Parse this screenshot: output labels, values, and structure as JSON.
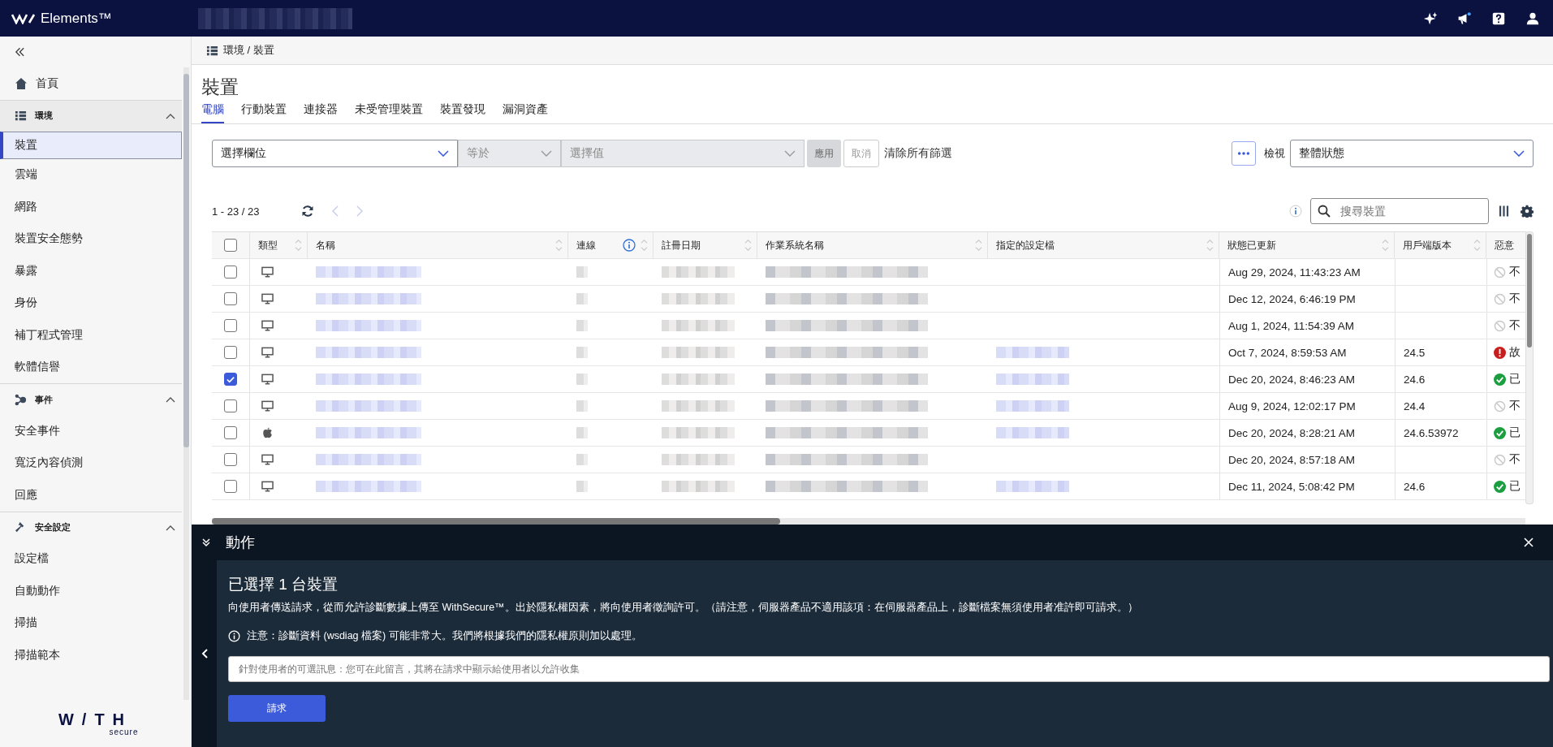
{
  "topbar": {
    "product": "Elements™"
  },
  "sidebar": {
    "home": "首頁",
    "sections": [
      {
        "title": "環境",
        "active": true,
        "expanded": true,
        "items": [
          {
            "label": "裝置",
            "selected": true
          },
          {
            "label": "雲端",
            "selected": false
          },
          {
            "label": "網路",
            "selected": false
          },
          {
            "label": "裝置安全態勢",
            "selected": false
          },
          {
            "label": "暴露",
            "selected": false
          },
          {
            "label": "身份",
            "selected": false
          },
          {
            "label": "補丁程式管理",
            "selected": false
          },
          {
            "label": "軟體信譽",
            "selected": false
          }
        ]
      },
      {
        "title": "事件",
        "active": false,
        "expanded": true,
        "items": [
          {
            "label": "安全事件",
            "selected": false
          },
          {
            "label": "寬泛內容偵測",
            "selected": false
          },
          {
            "label": "回應",
            "selected": false
          }
        ]
      },
      {
        "title": "安全設定",
        "active": false,
        "expanded": true,
        "items": [
          {
            "label": "設定檔",
            "selected": false
          },
          {
            "label": "自動動作",
            "selected": false
          },
          {
            "label": "掃描",
            "selected": false
          },
          {
            "label": "掃描範本",
            "selected": false
          }
        ]
      }
    ],
    "logo": "W/TH",
    "logo_sub": "secure"
  },
  "breadcrumb": "環境 / 裝置",
  "page_title": "裝置",
  "tabs": [
    {
      "label": "電腦",
      "selected": true
    },
    {
      "label": "行動裝置",
      "selected": false
    },
    {
      "label": "連接器",
      "selected": false
    },
    {
      "label": "未受管理裝置",
      "selected": false
    },
    {
      "label": "裝置發現",
      "selected": false
    },
    {
      "label": "漏洞資產",
      "selected": false
    }
  ],
  "filter": {
    "field": "選擇欄位",
    "operator": "等於",
    "value_placeholder": "選擇值",
    "apply": "應用",
    "cancel": "取消",
    "clear": "清除所有篩選",
    "view_label": "檢視",
    "view": "整體狀態"
  },
  "count": "1 - 23 / 23",
  "search": {
    "placeholder": "搜尋裝置"
  },
  "table": {
    "select_all": false,
    "columns": [
      "類型",
      "名稱",
      "連線",
      "註冊日期",
      "作業系統名稱",
      "指定的設定檔",
      "狀態已更新",
      "用戶端版本",
      "惡意"
    ],
    "rows": [
      {
        "checked": false,
        "kind": "pc",
        "profile": false,
        "updated": "Aug 29, 2024, 11:43:23 AM",
        "version": "",
        "malware": {
          "kind": "none",
          "text": "不"
        }
      },
      {
        "checked": false,
        "kind": "pc",
        "profile": false,
        "updated": "Dec 12, 2024, 6:46:19 PM",
        "version": "",
        "malware": {
          "kind": "none",
          "text": "不"
        }
      },
      {
        "checked": false,
        "kind": "pc",
        "profile": false,
        "updated": "Aug 1, 2024, 11:54:39 AM",
        "version": "",
        "malware": {
          "kind": "none",
          "text": "不"
        }
      },
      {
        "checked": false,
        "kind": "pc",
        "profile": true,
        "updated": "Oct 7, 2024, 8:59:53 AM",
        "version": "24.5",
        "malware": {
          "kind": "error",
          "text": "故"
        }
      },
      {
        "checked": true,
        "kind": "pc",
        "profile": true,
        "updated": "Dec 20, 2024, 8:46:23 AM",
        "version": "24.6",
        "malware": {
          "kind": "ok",
          "text": "已"
        }
      },
      {
        "checked": false,
        "kind": "pc",
        "profile": true,
        "updated": "Aug 9, 2024, 12:02:17 PM",
        "version": "24.4",
        "malware": {
          "kind": "none",
          "text": "不"
        }
      },
      {
        "checked": false,
        "kind": "mac",
        "profile": true,
        "updated": "Dec 20, 2024, 8:28:21 AM",
        "version": "24.6.53972",
        "malware": {
          "kind": "ok",
          "text": "已"
        }
      },
      {
        "checked": false,
        "kind": "pc",
        "profile": false,
        "updated": "Dec 20, 2024, 8:57:18 AM",
        "version": "",
        "malware": {
          "kind": "none",
          "text": "不"
        }
      },
      {
        "checked": false,
        "kind": "pc",
        "profile": true,
        "updated": "Dec 11, 2024, 5:08:42 PM",
        "version": "24.6",
        "malware": {
          "kind": "ok",
          "text": "已"
        }
      }
    ]
  },
  "actions": {
    "title": "動作",
    "heading": "已選擇 1 台裝置",
    "description": "向使用者傳送請求，從而允許診斷數據上傳至 WithSecure™。出於隱私權因素，將向使用者徵詢許可。（請注意，伺服器產品不適用該項：在伺服器產品上，診斷檔案無須使用者准許即可請求。）",
    "note": "注意：診斷資料 (wsdiag 檔案) 可能非常大。我們將根據我們的隱私權原則加以處理。",
    "message_placeholder": "針對使用者的可選訊息：您可在此留言，其將在請求中顯示給使用者以允許收集",
    "submit": "請求"
  }
}
